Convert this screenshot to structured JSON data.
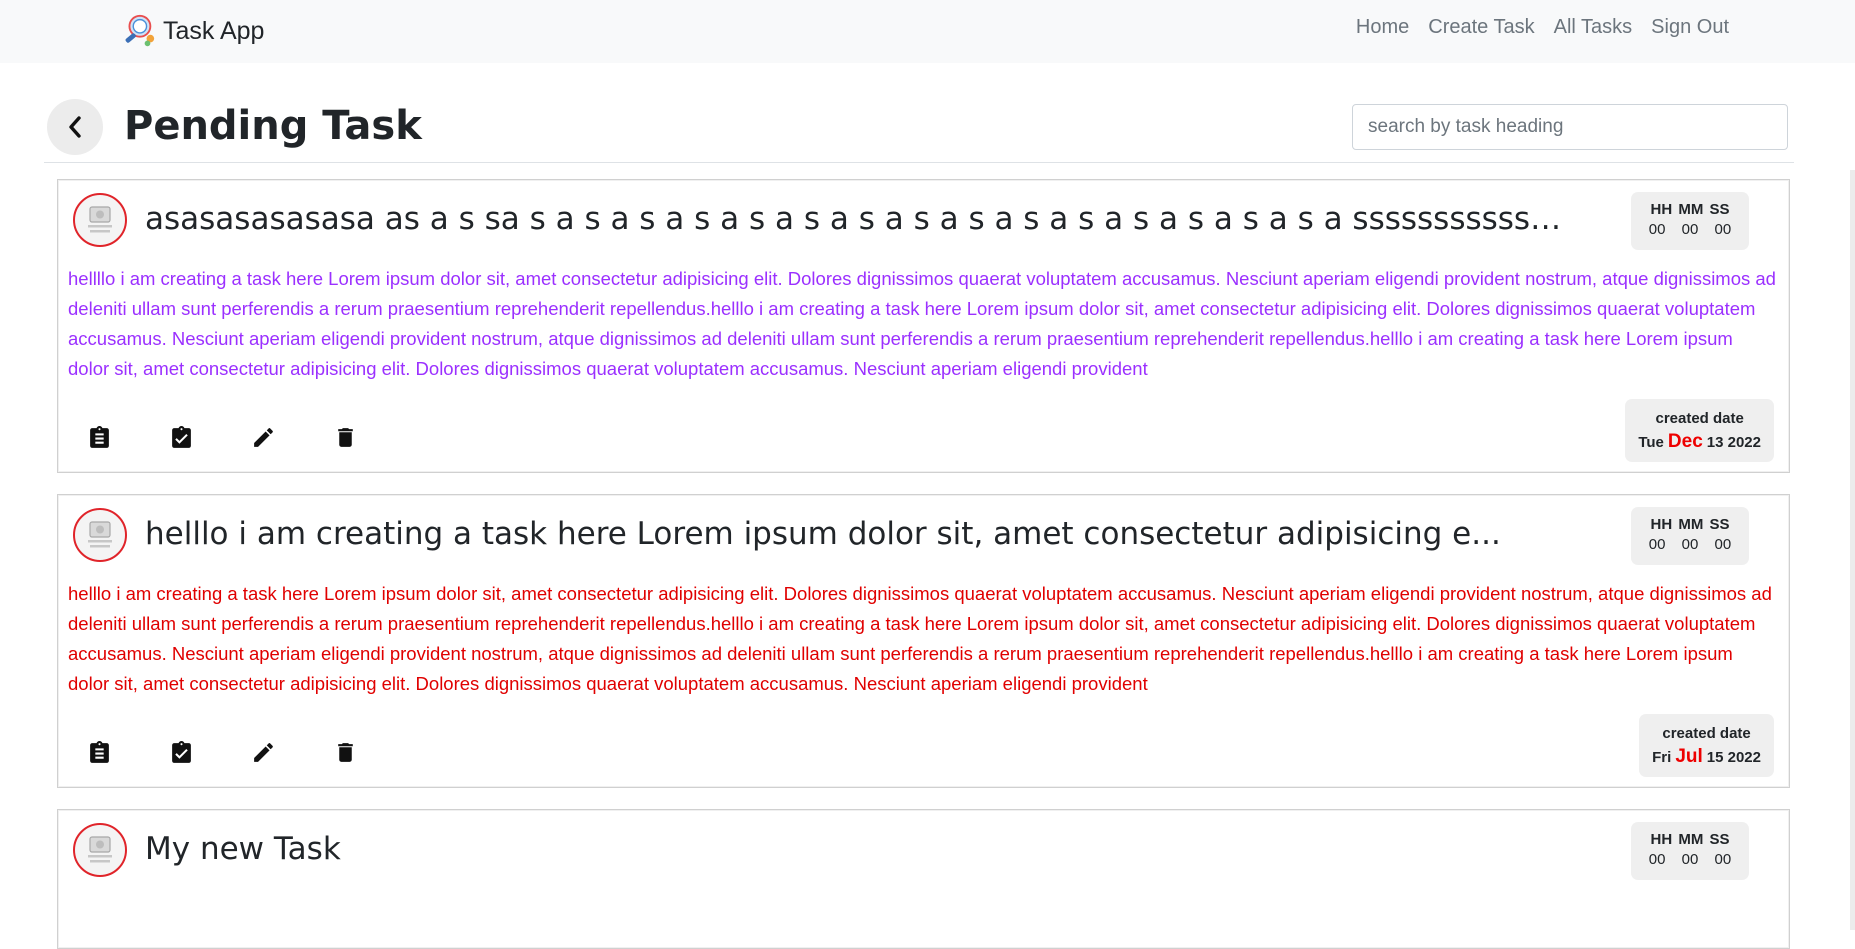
{
  "navbar": {
    "brand": "Task App",
    "links": [
      "Home",
      "Create Task",
      "All Tasks",
      "Sign Out"
    ]
  },
  "page": {
    "title": "Pending Task",
    "search_placeholder": "search by task heading"
  },
  "timer_labels": "HH MM SS",
  "created_label": "created date",
  "tasks": [
    {
      "heading": "asasasasasasa as a s sa s a s a s a s a s a s a s a s a s a s a s a s a s a s a s a sssssssssssssss...",
      "description": "hellllo i am creating a task here Lorem ipsum dolor sit, amet consectetur adipisicing elit. Dolores dignissimos quaerat voluptatem accusamus. Nesciunt aperiam eligendi provident nostrum, atque dignissimos ad deleniti ullam sunt perferendis a rerum praesentium reprehenderit repellendus.helllo i am creating a task here Lorem ipsum dolor sit, amet consectetur adipisicing elit. Dolores dignissimos quaerat voluptatem accusamus. Nesciunt aperiam eligendi provident nostrum, atque dignissimos ad deleniti ullam sunt perferendis a rerum praesentium reprehenderit repellendus.helllo i am creating a task here Lorem ipsum dolor sit, amet consectetur adipisicing elit. Dolores dignissimos quaerat voluptatem accusamus. Nesciunt aperiam eligendi provident",
      "desc_color": "#9b30ff",
      "timer_values": "00 00 00",
      "created_day": "Tue",
      "created_month": "Dec",
      "created_rest": "13 2022"
    },
    {
      "heading": "helllo i am creating a task here Lorem ipsum dolor sit, amet consectetur adipisicing e...",
      "description": "helllo i am creating a task here Lorem ipsum dolor sit, amet consectetur adipisicing elit. Dolores dignissimos quaerat voluptatem accusamus. Nesciunt aperiam eligendi provident nostrum, atque dignissimos ad deleniti ullam sunt perferendis a rerum praesentium reprehenderit repellendus.helllo i am creating a task here Lorem ipsum dolor sit, amet consectetur adipisicing elit. Dolores dignissimos quaerat voluptatem accusamus. Nesciunt aperiam eligendi provident nostrum, atque dignissimos ad deleniti ullam sunt perferendis a rerum praesentium reprehenderit repellendus.helllo i am creating a task here Lorem ipsum dolor sit, amet consectetur adipisicing elit. Dolores dignissimos quaerat voluptatem accusamus. Nesciunt aperiam eligendi provident",
      "desc_color": "#e00000",
      "timer_values": "00 00 00",
      "created_day": "Fri",
      "created_month": "Jul",
      "created_rest": "15 2022"
    },
    {
      "heading": "My new Task",
      "timer_values": "00 00 00"
    }
  ]
}
